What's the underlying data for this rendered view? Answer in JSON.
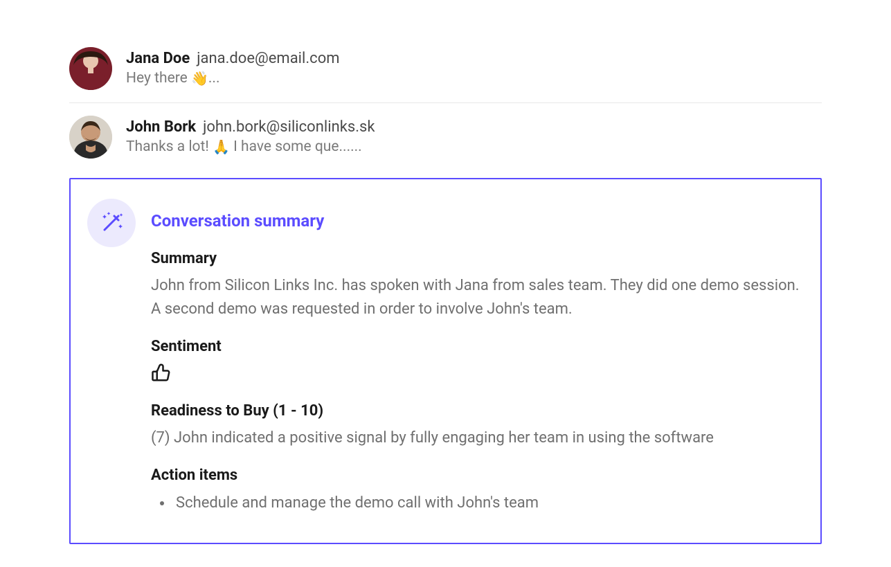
{
  "messages": [
    {
      "name": "Jana Doe",
      "email": "jana.doe@email.com",
      "preview_before": "Hey there ",
      "preview_emoji": "👋",
      "preview_after": "..."
    },
    {
      "name": "John Bork",
      "email": "john.bork@siliconlinks.sk",
      "preview_before": "Thanks a lot! ",
      "preview_emoji": "🙏",
      "preview_after": " I have some que......"
    }
  ],
  "summary": {
    "title": "Conversation summary",
    "sections": {
      "summary_heading": "Summary",
      "summary_text": "John from Silicon Links Inc. has spoken with Jana from sales team. They did one demo session. A second demo was requested in order to involve John's team.",
      "sentiment_heading": "Sentiment",
      "sentiment_value": "thumbs-up",
      "readiness_heading": "Readiness to Buy (1 - 10)",
      "readiness_text": "(7) John indicated a positive signal by fully engaging her team in using the software",
      "action_heading": "Action items",
      "action_items": [
        "Schedule and manage the demo call with John's team"
      ]
    }
  },
  "colors": {
    "accent": "#5b4cff"
  }
}
